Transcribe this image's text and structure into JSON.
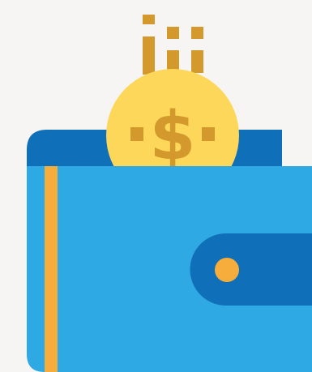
{
  "illustration": {
    "icon": "wallet-with-dollar-coin-icon",
    "coin_symbol": "$",
    "colors": {
      "background": "#f6f5f3",
      "coin": "#fdd75a",
      "coin_detail": "#d4992c",
      "wallet_back": "#0f6fb8",
      "wallet_front": "#2ea9e3",
      "wallet_strap": "#0f6fb8",
      "stripe": "#f7ad3b",
      "clasp_button": "#f7ad3b"
    }
  }
}
